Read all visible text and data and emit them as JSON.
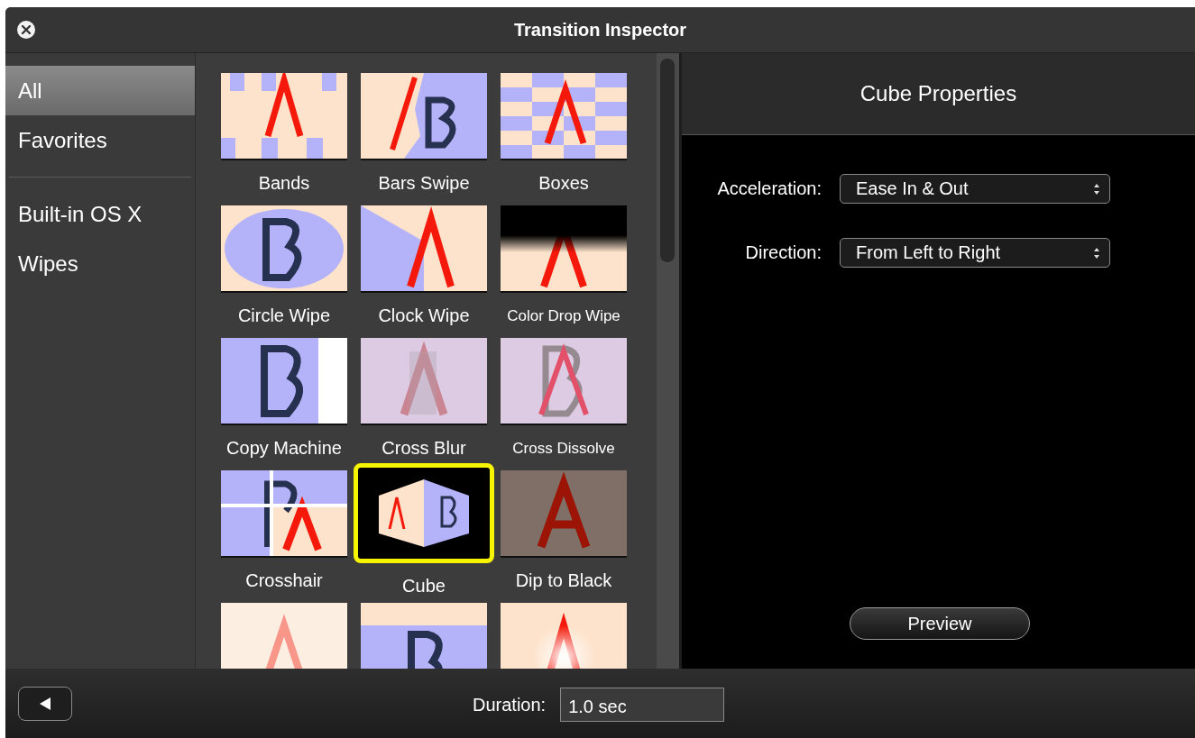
{
  "window": {
    "title": "Transition Inspector"
  },
  "sidebar": {
    "groups": [
      {
        "items": [
          {
            "label": "All",
            "selected": true
          },
          {
            "label": "Favorites",
            "selected": false
          }
        ]
      },
      {
        "items": [
          {
            "label": "Built-in OS X",
            "selected": false
          },
          {
            "label": "Wipes",
            "selected": false
          }
        ]
      }
    ]
  },
  "transitions": [
    {
      "name": "Bands",
      "kind": "bands",
      "selected": false
    },
    {
      "name": "Bars Swipe",
      "kind": "bars",
      "selected": false
    },
    {
      "name": "Boxes",
      "kind": "boxes",
      "selected": false
    },
    {
      "name": "Circle Wipe",
      "kind": "circle",
      "selected": false
    },
    {
      "name": "Clock Wipe",
      "kind": "clock",
      "selected": false
    },
    {
      "name": "Color Drop Wipe",
      "kind": "colordrop",
      "selected": false
    },
    {
      "name": "Copy Machine",
      "kind": "copy",
      "selected": false
    },
    {
      "name": "Cross Blur",
      "kind": "blur",
      "selected": false
    },
    {
      "name": "Cross Dissolve",
      "kind": "dissolve",
      "selected": false
    },
    {
      "name": "Crosshair",
      "kind": "crosshair",
      "selected": false
    },
    {
      "name": "Cube",
      "kind": "cube",
      "selected": true
    },
    {
      "name": "Dip to Black",
      "kind": "dip",
      "selected": false
    },
    {
      "kind": "fade",
      "selected": false
    },
    {
      "kind": "slide",
      "selected": false
    },
    {
      "kind": "flash",
      "selected": false
    }
  ],
  "properties": {
    "title": "Cube Properties",
    "fields": [
      {
        "label": "Acceleration:",
        "value": "Ease In & Out"
      },
      {
        "label": "Direction:",
        "value": "From Left to Right"
      }
    ],
    "preview_button": "Preview"
  },
  "footer": {
    "duration_label": "Duration:",
    "duration_value": "1.0 sec"
  }
}
